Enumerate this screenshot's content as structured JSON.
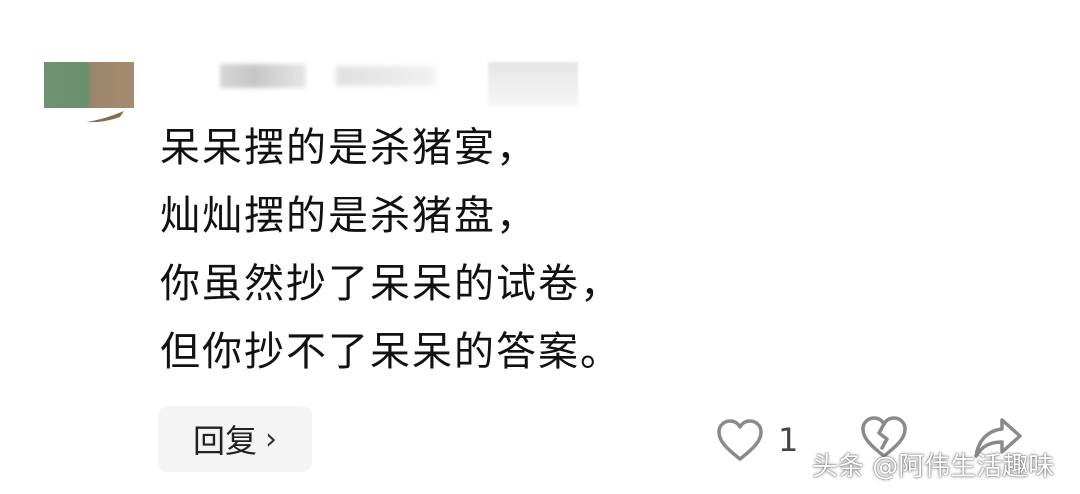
{
  "comment": {
    "lines": [
      "呆呆摆的是杀猪宴，",
      "灿灿摆的是杀猪盘，",
      "你虽然抄了呆呆的试卷，",
      "但你抄不了呆呆的答案。"
    ]
  },
  "actions": {
    "reply_label": "回复",
    "reply_chevron": "›",
    "like_count": "1",
    "like_icon": "heart-outline-icon",
    "dislike_icon": "broken-heart-icon",
    "share_icon": "share-arrow-icon"
  },
  "watermark": {
    "text": "头条 @阿伟生活趣味"
  },
  "colors": {
    "text": "#111111",
    "icon": "#8a8a8a",
    "reply_bg": "#f4f4f4"
  }
}
